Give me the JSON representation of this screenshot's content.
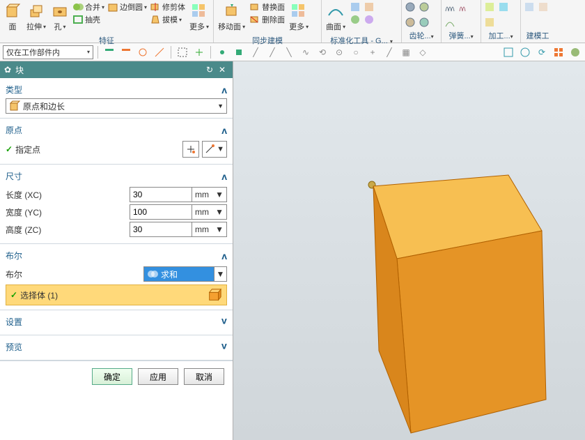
{
  "ribbon": {
    "groups": [
      {
        "label": "特征",
        "big": [
          {
            "name": "face",
            "label": "面"
          },
          {
            "name": "extrude",
            "label": "拉伸"
          },
          {
            "name": "hole",
            "label": "孔"
          }
        ],
        "mini": [
          {
            "name": "unite",
            "label": "合并"
          },
          {
            "name": "shell",
            "label": "抽壳"
          }
        ],
        "mini2": [
          {
            "name": "chamfer",
            "label": "边倒圆"
          }
        ],
        "mini3": [
          {
            "name": "trim",
            "label": "修剪体"
          },
          {
            "name": "draft",
            "label": "拔模"
          }
        ],
        "more": {
          "label": "更多"
        }
      },
      {
        "label": "同步建模",
        "big": [
          {
            "name": "moveface",
            "label": "移动面"
          }
        ],
        "mini": [
          {
            "name": "replaceface",
            "label": "替换面"
          },
          {
            "name": "deleteface",
            "label": "删除面"
          }
        ],
        "more": {
          "label": "更多"
        }
      },
      {
        "label": "标准化工具 - G...",
        "big": [
          {
            "name": "surface",
            "label": "曲面"
          }
        ]
      },
      {
        "label": "齿轮...",
        "icons": 4
      },
      {
        "label": "弹簧...",
        "icons": 3
      },
      {
        "label": "加工...",
        "icons": 3
      },
      {
        "label": "建模工",
        "icons": 2
      }
    ]
  },
  "toolbar": {
    "combo": "仅在工作部件内"
  },
  "panel": {
    "title": "块",
    "sections": {
      "type": {
        "head": "类型",
        "value": "原点和边长"
      },
      "origin": {
        "head": "原点",
        "point_label": "指定点"
      },
      "dim": {
        "head": "尺寸",
        "rows": [
          {
            "label": "长度 (XC)",
            "value": "30",
            "unit": "mm"
          },
          {
            "label": "宽度 (YC)",
            "value": "100",
            "unit": "mm"
          },
          {
            "label": "高度 (ZC)",
            "value": "30",
            "unit": "mm"
          }
        ]
      },
      "bool": {
        "head": "布尔",
        "label": "布尔",
        "value": "求和",
        "select": "选择体 (1)"
      },
      "settings": {
        "head": "设置"
      },
      "preview": {
        "head": "预览"
      }
    },
    "buttons": {
      "ok": "确定",
      "apply": "应用",
      "cancel": "取消"
    }
  }
}
